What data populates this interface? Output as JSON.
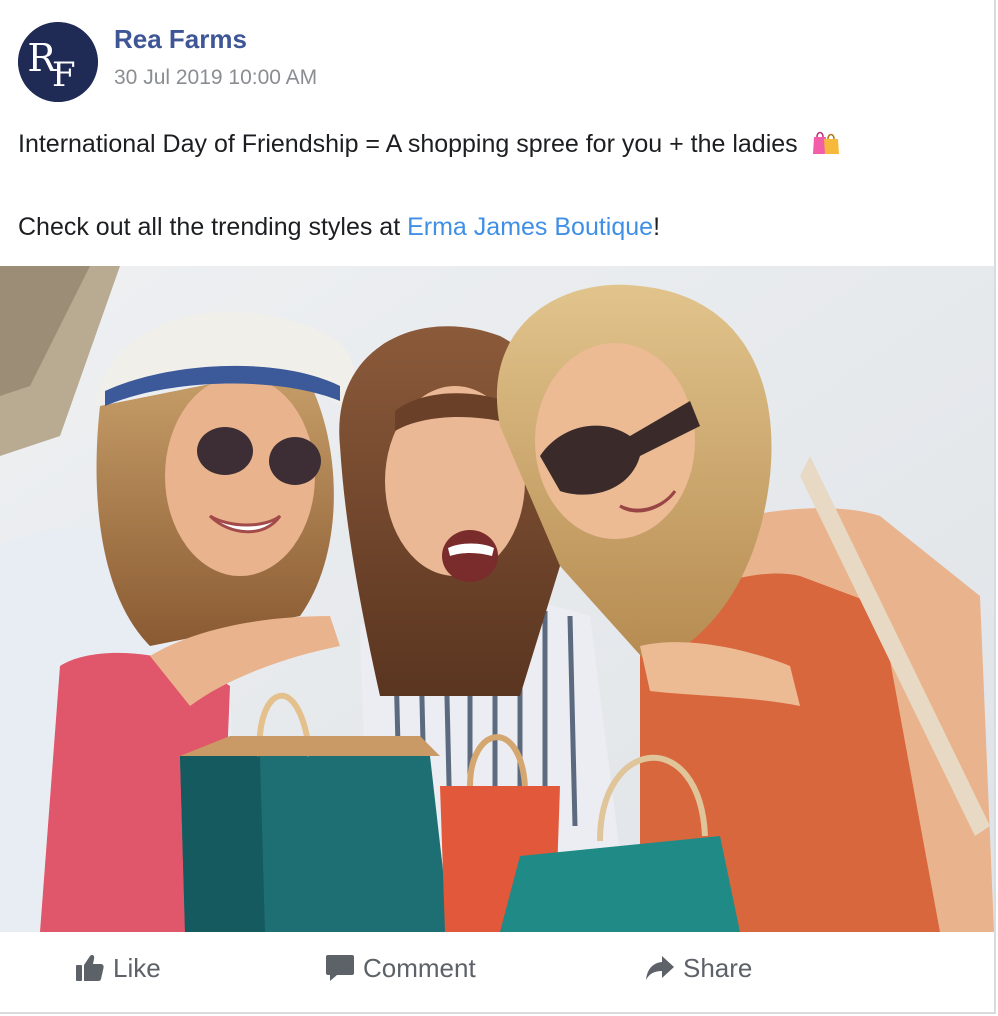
{
  "post": {
    "author": "Rea Farms",
    "avatar_monogram": "RF",
    "timestamp": "30 Jul 2019 10:00 AM",
    "text_line1": "International Day of Friendship = A shopping spree for you + the ladies",
    "emoji_icon": "shopping-bags-icon",
    "text_line2_prefix": "Check out all the trending styles at ",
    "text_line2_link": "Erma James Boutique",
    "text_line2_suffix": "!",
    "image_description_icon": "photo-of-three-women-with-shopping-bags"
  },
  "actions": {
    "like_label": "Like",
    "comment_label": "Comment",
    "share_label": "Share"
  },
  "colors": {
    "author_name": "#3e5696",
    "link": "#3f8fe6",
    "avatar_bg": "#1f2a55",
    "action_text": "#5d6168"
  }
}
